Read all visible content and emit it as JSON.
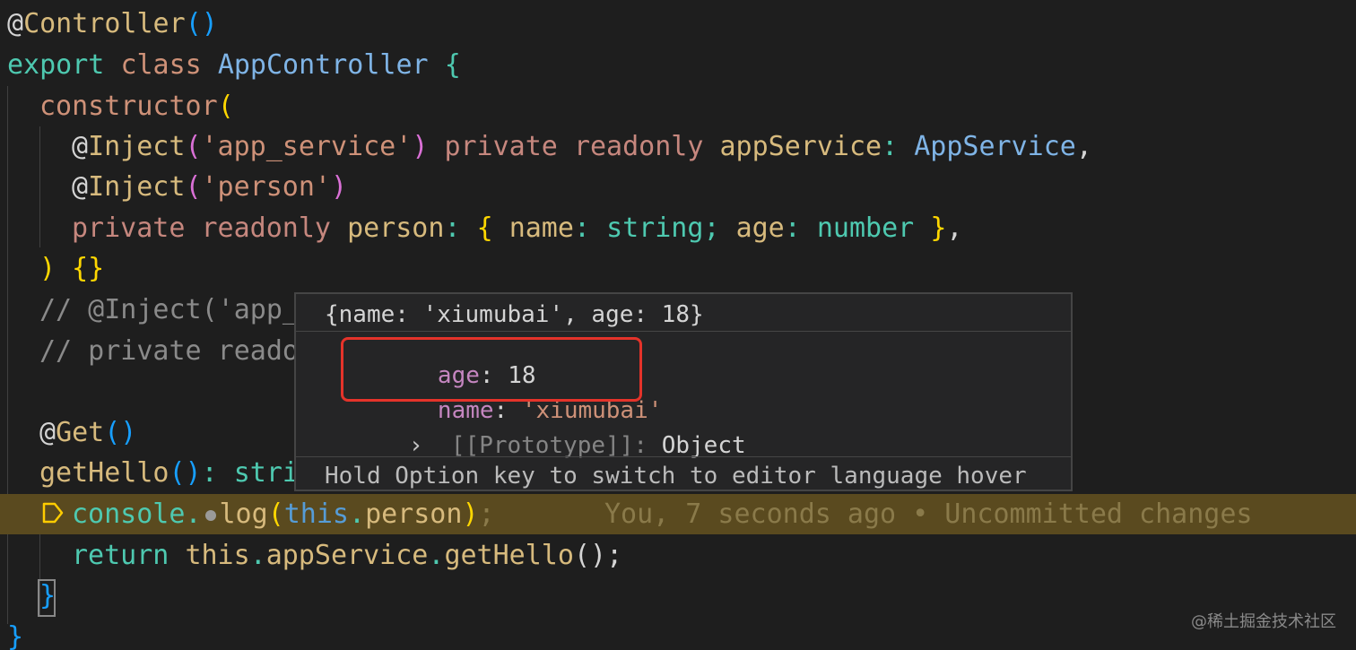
{
  "code": {
    "line1": {
      "at": "@",
      "name": "Controller",
      "paren": "()"
    },
    "line2": {
      "export": "export",
      "class": "class",
      "name": "AppController",
      "brace": "{"
    },
    "line3": {
      "fn": "constructor",
      "paren": "("
    },
    "line4": {
      "at": "@",
      "name": "Inject",
      "open": "(",
      "str": "'app_service'",
      "close": ")",
      "private": "private",
      "readonly": "readonly",
      "ident": "appService",
      "colon": ":",
      "type": "AppService",
      "comma": ","
    },
    "line5": {
      "at": "@",
      "name": "Inject",
      "open": "(",
      "str": "'person'",
      "close": ")"
    },
    "line6": {
      "private": "private",
      "readonly": "readonly",
      "ident": "person",
      "colon": ":",
      "brace_open": "{",
      "name_key": "name",
      "name_type": "string",
      "semi": ";",
      "age_key": "age",
      "age_type": "number",
      "brace_close": "}",
      "comma": ","
    },
    "line7": {
      "text": ") {}"
    },
    "line8": {
      "text": "// @Inject('app_"
    },
    "line9": {
      "text": "// private reado"
    },
    "line11": {
      "at": "@",
      "name": "Get",
      "paren": "()"
    },
    "line12": {
      "name": "getHello",
      "paren": "()",
      "colon": ":",
      "rest": "stri"
    },
    "line13": {
      "console": "console",
      "dot": ".",
      "log": "log",
      "open": "(",
      "this": "this",
      "dot2": ".",
      "prop": "person",
      "close": ")",
      "semi": ";",
      "blame": "You, 7 seconds ago • Uncommitted changes"
    },
    "line14": {
      "return": "return",
      "this": "this",
      "dot": ".",
      "svc": "appService",
      "dot2": ".",
      "fn": "getHello",
      "paren": "()",
      "semi": ";"
    },
    "line15": {
      "text": "}"
    },
    "line16": {
      "text": "}"
    }
  },
  "hover": {
    "header": "{name: 'xiumubai', age: 18}",
    "age_key": "age",
    "age_colon": ":",
    "age_val": "18",
    "name_key": "name",
    "name_colon": ":",
    "name_val": "'xiumubai'",
    "chevron": "›",
    "proto_key": "[[Prototype]]",
    "proto_colon": ":",
    "proto_val": "Object",
    "footer": "Hold Option key to switch to editor language hover"
  },
  "watermark": "@稀土掘金技术社区",
  "colors": {
    "background": "#1e1e1e",
    "highlight_line": "#5a4a1f",
    "annotation_box": "#e5332a"
  }
}
